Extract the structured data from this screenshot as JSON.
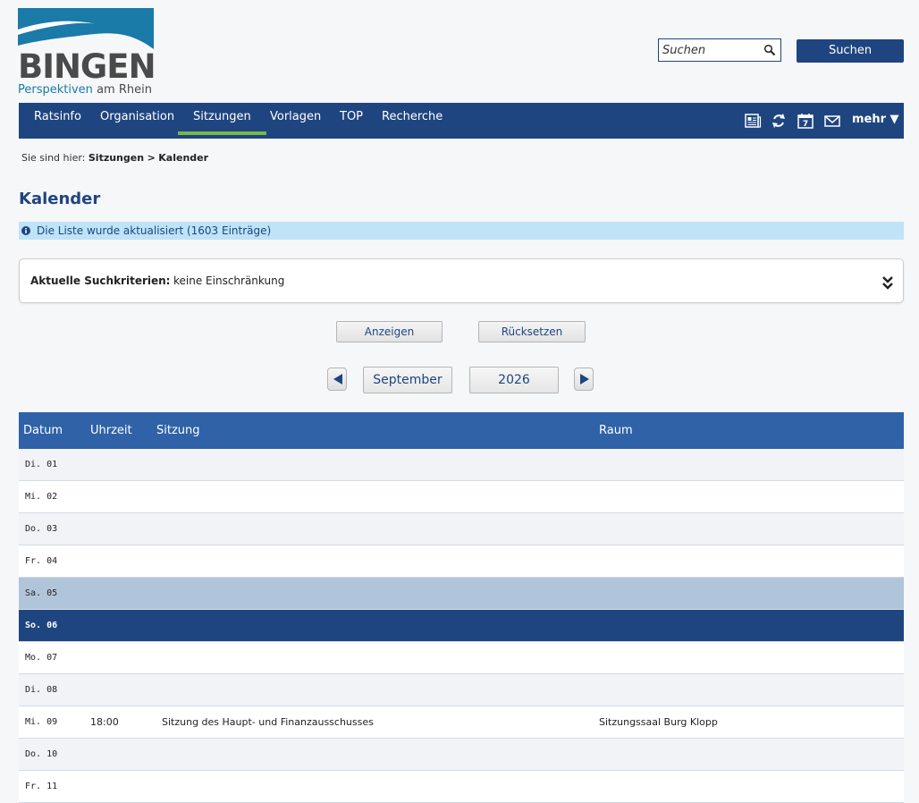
{
  "header": {
    "logo_wordmark": "BINGEN",
    "logo_tagline_1": "Perspektiven",
    "logo_tagline_2": "am Rhein",
    "search_placeholder": "Suchen",
    "search_button": "Suchen"
  },
  "nav": {
    "items": [
      {
        "label": "Ratsinfo"
      },
      {
        "label": "Organisation"
      },
      {
        "label": "Sitzungen"
      },
      {
        "label": "Vorlagen"
      },
      {
        "label": "TOP"
      },
      {
        "label": "Recherche"
      }
    ],
    "active": "Sitzungen",
    "more_label": "mehr ▼",
    "icons": [
      "newspaper-icon",
      "refresh-icon",
      "calendar-icon",
      "mail-icon"
    ]
  },
  "breadcrumb": {
    "prefix": "Sie sind hier:",
    "path_1": "Sitzungen",
    "sep": ">",
    "path_2": "Kalender"
  },
  "page": {
    "title": "Kalender",
    "info": "Die Liste wurde aktualisiert (1603 Einträge)",
    "criteria_label": "Aktuelle Suchkriterien:",
    "criteria_value": "keine Einschränkung",
    "show_button": "Anzeigen",
    "reset_button": "Rücksetzen",
    "month": "September",
    "year": "2026"
  },
  "table": {
    "headers": {
      "date": "Datum",
      "time": "Uhrzeit",
      "session": "Sitzung",
      "room": "Raum"
    },
    "rows": [
      {
        "date": "Di. 01",
        "time": "",
        "session": "",
        "room": "",
        "kind": "odd"
      },
      {
        "date": "Mi. 02",
        "time": "",
        "session": "",
        "room": "",
        "kind": "even"
      },
      {
        "date": "Do. 03",
        "time": "",
        "session": "",
        "room": "",
        "kind": "odd"
      },
      {
        "date": "Fr. 04",
        "time": "",
        "session": "",
        "room": "",
        "kind": "even"
      },
      {
        "date": "Sa. 05",
        "time": "",
        "session": "",
        "room": "",
        "kind": "sat"
      },
      {
        "date": "So. 06",
        "time": "",
        "session": "",
        "room": "",
        "kind": "sun"
      },
      {
        "date": "Mo. 07",
        "time": "",
        "session": "",
        "room": "",
        "kind": "even"
      },
      {
        "date": "Di. 08",
        "time": "",
        "session": "",
        "room": "",
        "kind": "odd"
      },
      {
        "date": "Mi. 09",
        "time": "18:00",
        "session": "Sitzung des Haupt- und Finanzausschusses",
        "room": "Sitzungssaal Burg Klopp",
        "kind": "even"
      },
      {
        "date": "Do. 10",
        "time": "",
        "session": "",
        "room": "",
        "kind": "odd"
      },
      {
        "date": "Fr. 11",
        "time": "",
        "session": "",
        "room": "",
        "kind": "even"
      }
    ]
  },
  "colors": {
    "brand_blue": "#1f4580",
    "header_blue": "#2f62a7",
    "active_green": "#7ab648",
    "info_bg": "#bfe3f7",
    "logo_teal": "#1a7aa8"
  }
}
